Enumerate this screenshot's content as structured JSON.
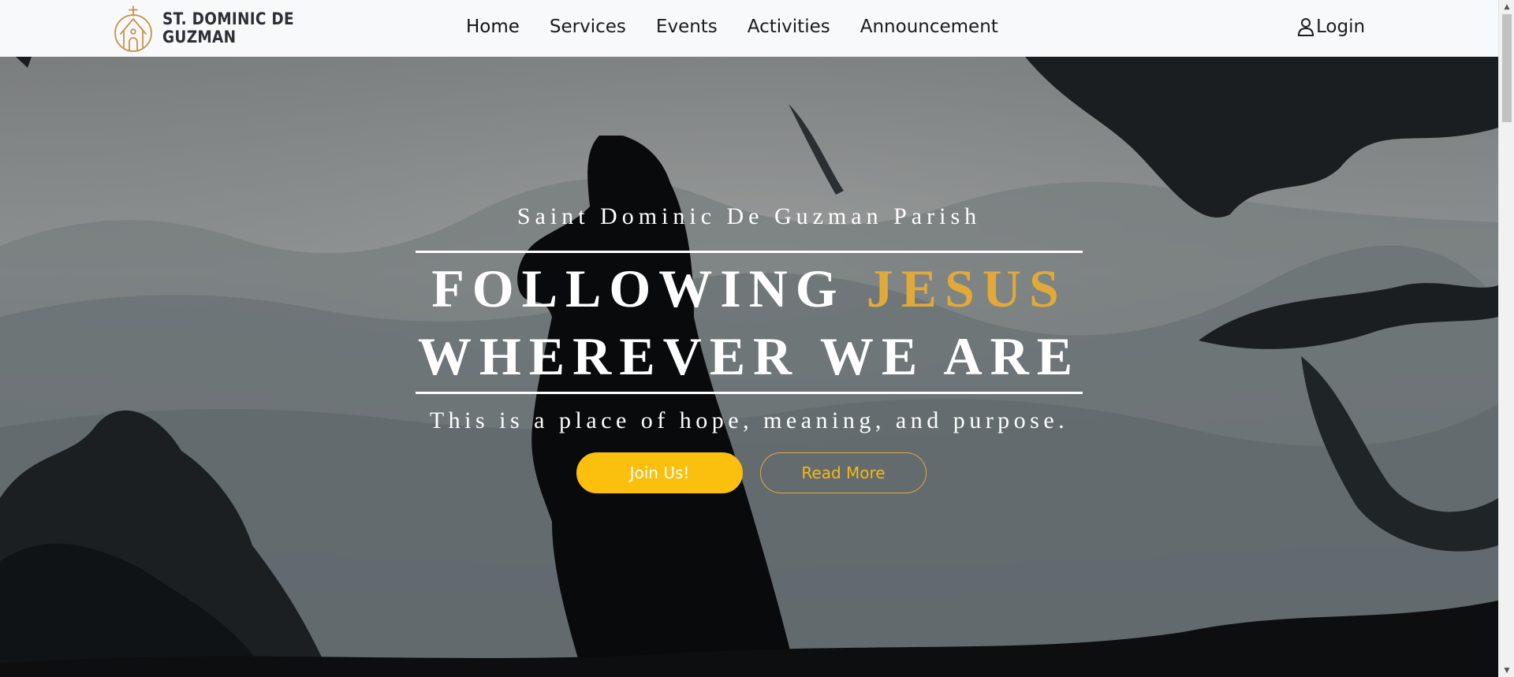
{
  "brand": {
    "line1": "ST. DOMINIC DE",
    "line2": "GUZMAN",
    "logo_icon": "church-icon",
    "logo_color": "#c8914a"
  },
  "nav": {
    "items": [
      {
        "label": "Home"
      },
      {
        "label": "Services"
      },
      {
        "label": "Events"
      },
      {
        "label": "Activities"
      },
      {
        "label": "Announcement"
      }
    ],
    "login_label": "Login",
    "login_icon": "user-icon"
  },
  "hero": {
    "subtitle": "Saint Dominic De Guzman Parish",
    "headline_part1": "FOLLOWING",
    "headline_accent": "JESUS",
    "headline_line2": "WHEREVER WE ARE",
    "tagline": "This is a place of hope, meaning, and purpose.",
    "primary_button": "Join Us!",
    "secondary_button": "Read More",
    "accent_color": "#e0a93a",
    "button_color": "#fbbf0e"
  },
  "scrollbar": {
    "up_icon": "scroll-up-arrow-icon",
    "down_icon": "scroll-down-arrow-icon"
  }
}
